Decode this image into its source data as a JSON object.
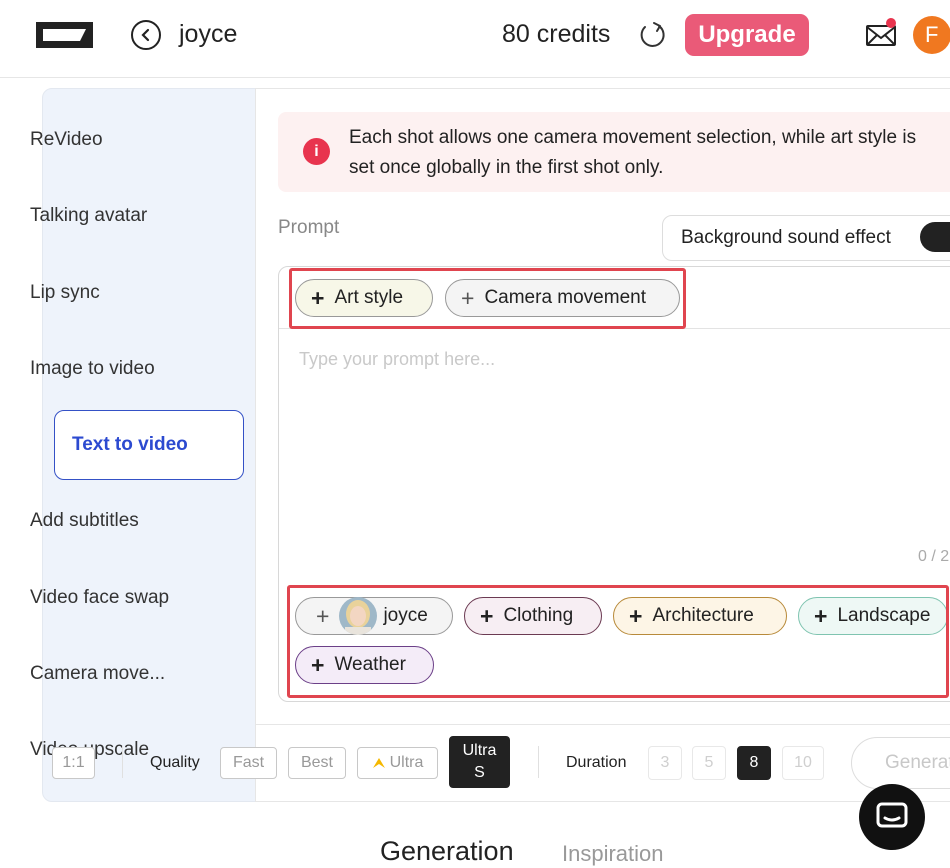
{
  "header": {
    "user_name": "joyce",
    "credits": "80 credits",
    "upgrade_label": "Upgrade",
    "avatar_initial": "F"
  },
  "sidebar": {
    "items": [
      {
        "label": "ReVideo"
      },
      {
        "label": "Talking avatar"
      },
      {
        "label": "Lip sync"
      },
      {
        "label": "Image to video"
      },
      {
        "label": "Text to video"
      },
      {
        "label": "Add subtitles"
      },
      {
        "label": "Video face swap"
      },
      {
        "label": "Camera move..."
      },
      {
        "label": "Video upscale"
      }
    ],
    "active": "Text to video"
  },
  "notice": {
    "text": "Each shot allows one camera movement selection, while art style is set once globally in the first shot only."
  },
  "prompt": {
    "label": "Prompt",
    "background_sound_label": "Background sound effect",
    "placeholder": "Type your prompt here...",
    "counter": "0 / 2",
    "top_chips": [
      "Art style",
      "Camera movement"
    ],
    "bottom_chips": [
      "joyce",
      "Clothing",
      "Architecture",
      "Landscape",
      "Weather"
    ]
  },
  "toolbar": {
    "aspect_ratio": "1:1",
    "quality_label": "Quality",
    "quality_options": [
      "Fast",
      "Best",
      "Ultra",
      "Ultra S"
    ],
    "quality_selected": "Ultra S",
    "duration_label": "Duration",
    "duration_options": [
      "3",
      "5",
      "8",
      "10"
    ],
    "duration_selected": "8",
    "generate_label": "Generate"
  },
  "bottom_tabs": [
    "Generation",
    "Inspiration"
  ],
  "colors": {
    "accent": "#2c4ad0",
    "upgrade": "#ea5a78",
    "highlight": "#e0454f",
    "notice_bg": "#fdf1f1",
    "sidebar_bg": "#eef3fb"
  }
}
